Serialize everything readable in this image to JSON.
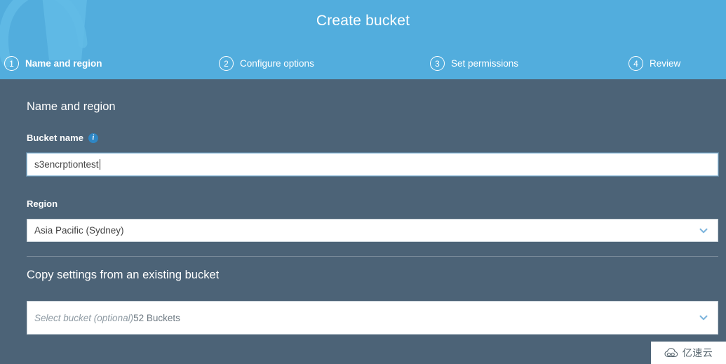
{
  "header": {
    "title": "Create bucket",
    "background_color": "#52addd",
    "steps": [
      {
        "number": "1",
        "label": "Name and region",
        "active": true
      },
      {
        "number": "2",
        "label": "Configure options",
        "active": false
      },
      {
        "number": "3",
        "label": "Set permissions",
        "active": false
      },
      {
        "number": "4",
        "label": "Review",
        "active": false
      }
    ]
  },
  "body": {
    "background_color": "#4c6377",
    "section_title": "Name and region",
    "bucket_name": {
      "label": "Bucket name",
      "info_glyph": "i",
      "value": "s3encrptiontest"
    },
    "region": {
      "label": "Region",
      "value": "Asia Pacific (Sydney)"
    },
    "copy_settings": {
      "title": "Copy settings from an existing bucket",
      "placeholder": "Select bucket (optional)",
      "count_label": "52 Buckets"
    }
  },
  "watermark": {
    "text": "亿速云"
  }
}
